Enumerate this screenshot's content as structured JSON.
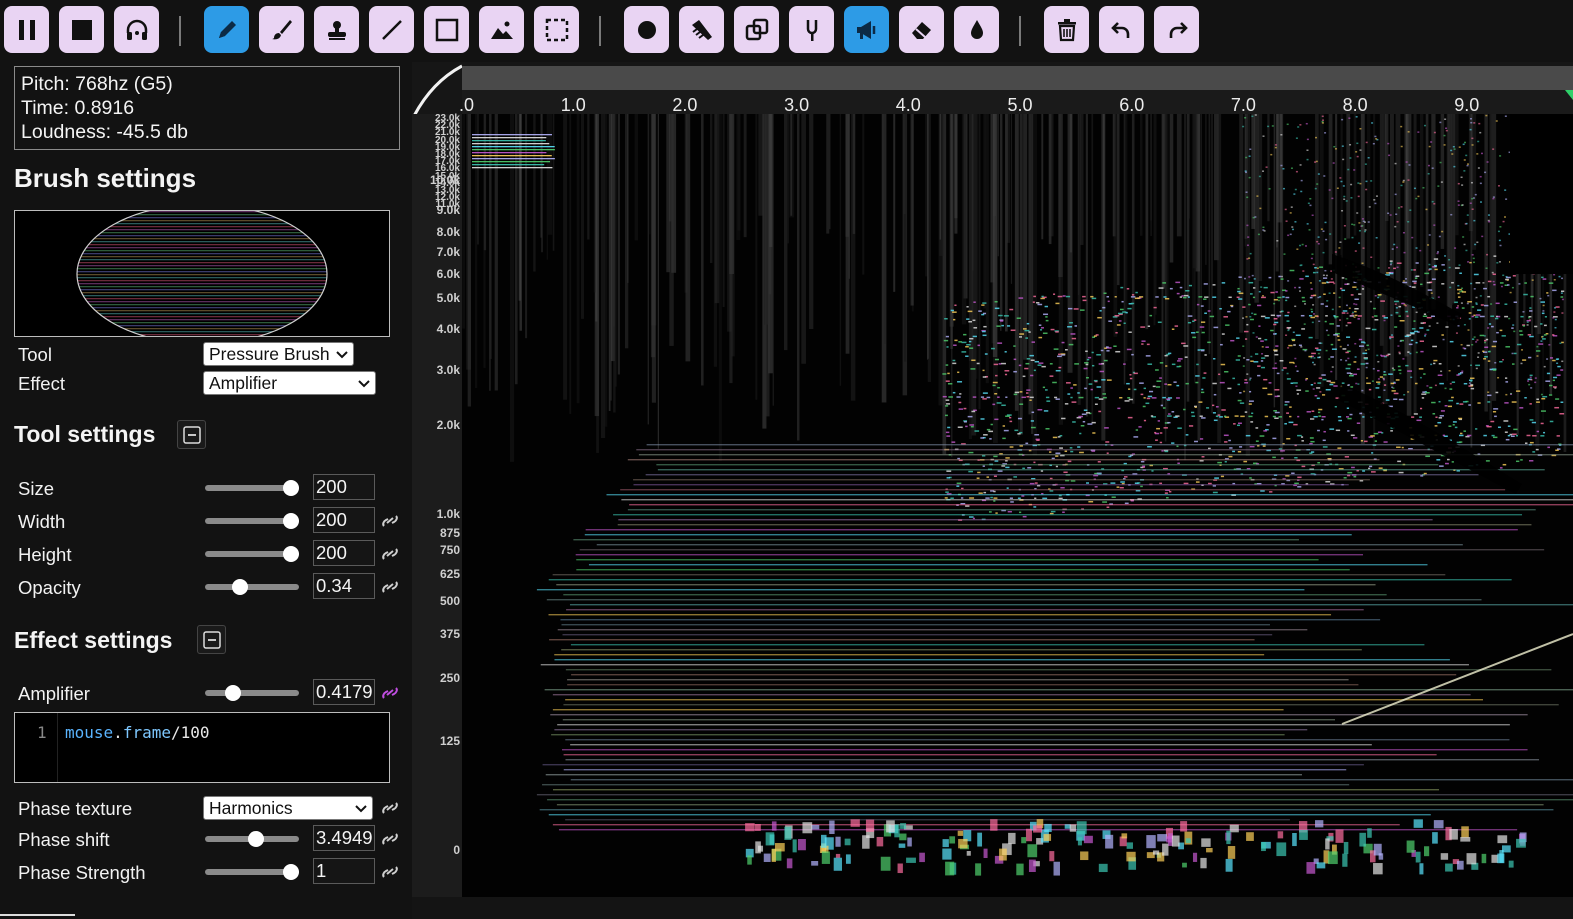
{
  "readout": {
    "pitch": "Pitch: 768hz (G5)",
    "time": "Time: 0.8916",
    "loudness": "Loudness: -45.5 db"
  },
  "toolbar": {
    "play_pause": "pause-icon",
    "stop": "stop-icon",
    "listen": "headphones-icon",
    "tools": [
      "pen-icon",
      "brush-icon",
      "stamp-icon",
      "line-icon",
      "rectangle-icon",
      "image-icon",
      "selection-icon",
      "circle-icon",
      "comb-icon",
      "clone-icon",
      "tuning-fork-icon",
      "amplifier-icon",
      "eraser-icon",
      "blur-icon",
      "trash-icon",
      "undo-icon",
      "redo-icon"
    ],
    "active_tools": [
      "pen-icon",
      "amplifier-icon"
    ],
    "accent": "#2d9be6",
    "button_bg": "#e9d4f3"
  },
  "brush_settings": {
    "title": "Brush settings",
    "tool_label": "Tool",
    "tool_value": "Pressure Brush",
    "effect_label": "Effect",
    "effect_value": "Amplifier"
  },
  "tool_settings": {
    "title": "Tool settings",
    "size_label": "Size",
    "size_value": "200",
    "size_level": 1.0,
    "width_label": "Width",
    "width_value": "200",
    "width_level": 1.0,
    "height_label": "Height",
    "height_value": "200",
    "height_level": 1.0,
    "opacity_label": "Opacity",
    "opacity_value": "0.34",
    "opacity_level": 0.34
  },
  "effect_settings": {
    "title": "Effect settings",
    "amplifier_label": "Amplifier",
    "amplifier_value": "0.4179",
    "amplifier_level": 0.25,
    "code_line_number": "1",
    "code_obj": "mouse",
    "code_dot": ".",
    "code_prop": "frame",
    "code_rest": "/100",
    "phase_texture_label": "Phase texture",
    "phase_texture_value": "Harmonics",
    "phase_shift_label": "Phase shift",
    "phase_shift_value": "3.4949",
    "phase_shift_level": 0.55,
    "phase_strength_label": "Phase Strength",
    "phase_strength_value": "1",
    "phase_strength_level": 1.0
  },
  "time_ruler": {
    "ticks": [
      ".0",
      "1.0",
      "2.0",
      "3.0",
      "4.0",
      "5.0",
      "6.0",
      "7.0",
      "8.0",
      "9.0"
    ]
  },
  "freq_ruler": {
    "dense_labels": [
      "23.0k",
      "22.0k",
      "21.0k",
      "20.0k",
      "19.0k",
      "18.0k",
      "17.0k",
      "16.0k",
      "15.0k",
      "14.0k",
      "13.0k",
      "12.0k",
      "11.0k"
    ],
    "labels": [
      "10.0k",
      "9.0k",
      "8.0k",
      "7.0k",
      "6.0k",
      "5.0k",
      "4.0k",
      "3.0k",
      "2.0k",
      "1.0k",
      "875",
      "750",
      "625",
      "500",
      "375",
      "250",
      "125",
      "0"
    ]
  }
}
